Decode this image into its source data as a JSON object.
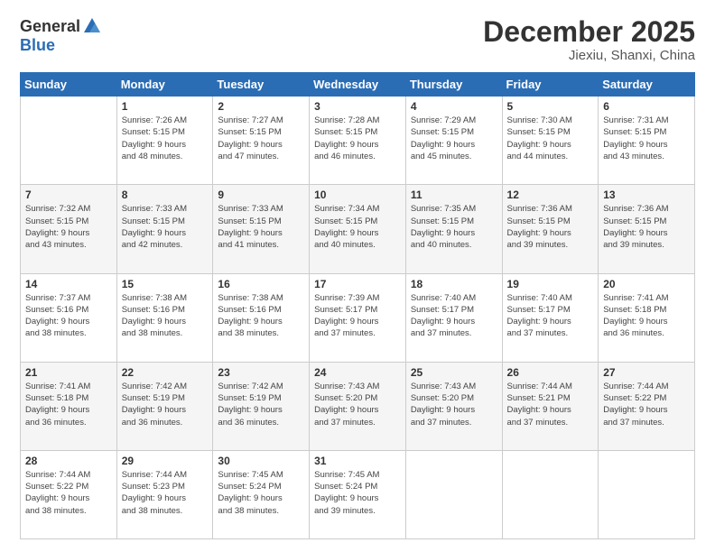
{
  "logo": {
    "general": "General",
    "blue": "Blue"
  },
  "title": "December 2025",
  "location": "Jiexiu, Shanxi, China",
  "days_of_week": [
    "Sunday",
    "Monday",
    "Tuesday",
    "Wednesday",
    "Thursday",
    "Friday",
    "Saturday"
  ],
  "weeks": [
    [
      {
        "day": "",
        "content": ""
      },
      {
        "day": "1",
        "content": "Sunrise: 7:26 AM\nSunset: 5:15 PM\nDaylight: 9 hours\nand 48 minutes."
      },
      {
        "day": "2",
        "content": "Sunrise: 7:27 AM\nSunset: 5:15 PM\nDaylight: 9 hours\nand 47 minutes."
      },
      {
        "day": "3",
        "content": "Sunrise: 7:28 AM\nSunset: 5:15 PM\nDaylight: 9 hours\nand 46 minutes."
      },
      {
        "day": "4",
        "content": "Sunrise: 7:29 AM\nSunset: 5:15 PM\nDaylight: 9 hours\nand 45 minutes."
      },
      {
        "day": "5",
        "content": "Sunrise: 7:30 AM\nSunset: 5:15 PM\nDaylight: 9 hours\nand 44 minutes."
      },
      {
        "day": "6",
        "content": "Sunrise: 7:31 AM\nSunset: 5:15 PM\nDaylight: 9 hours\nand 43 minutes."
      }
    ],
    [
      {
        "day": "7",
        "content": "Sunrise: 7:32 AM\nSunset: 5:15 PM\nDaylight: 9 hours\nand 43 minutes."
      },
      {
        "day": "8",
        "content": "Sunrise: 7:33 AM\nSunset: 5:15 PM\nDaylight: 9 hours\nand 42 minutes."
      },
      {
        "day": "9",
        "content": "Sunrise: 7:33 AM\nSunset: 5:15 PM\nDaylight: 9 hours\nand 41 minutes."
      },
      {
        "day": "10",
        "content": "Sunrise: 7:34 AM\nSunset: 5:15 PM\nDaylight: 9 hours\nand 40 minutes."
      },
      {
        "day": "11",
        "content": "Sunrise: 7:35 AM\nSunset: 5:15 PM\nDaylight: 9 hours\nand 40 minutes."
      },
      {
        "day": "12",
        "content": "Sunrise: 7:36 AM\nSunset: 5:15 PM\nDaylight: 9 hours\nand 39 minutes."
      },
      {
        "day": "13",
        "content": "Sunrise: 7:36 AM\nSunset: 5:15 PM\nDaylight: 9 hours\nand 39 minutes."
      }
    ],
    [
      {
        "day": "14",
        "content": "Sunrise: 7:37 AM\nSunset: 5:16 PM\nDaylight: 9 hours\nand 38 minutes."
      },
      {
        "day": "15",
        "content": "Sunrise: 7:38 AM\nSunset: 5:16 PM\nDaylight: 9 hours\nand 38 minutes."
      },
      {
        "day": "16",
        "content": "Sunrise: 7:38 AM\nSunset: 5:16 PM\nDaylight: 9 hours\nand 38 minutes."
      },
      {
        "day": "17",
        "content": "Sunrise: 7:39 AM\nSunset: 5:17 PM\nDaylight: 9 hours\nand 37 minutes."
      },
      {
        "day": "18",
        "content": "Sunrise: 7:40 AM\nSunset: 5:17 PM\nDaylight: 9 hours\nand 37 minutes."
      },
      {
        "day": "19",
        "content": "Sunrise: 7:40 AM\nSunset: 5:17 PM\nDaylight: 9 hours\nand 37 minutes."
      },
      {
        "day": "20",
        "content": "Sunrise: 7:41 AM\nSunset: 5:18 PM\nDaylight: 9 hours\nand 36 minutes."
      }
    ],
    [
      {
        "day": "21",
        "content": "Sunrise: 7:41 AM\nSunset: 5:18 PM\nDaylight: 9 hours\nand 36 minutes."
      },
      {
        "day": "22",
        "content": "Sunrise: 7:42 AM\nSunset: 5:19 PM\nDaylight: 9 hours\nand 36 minutes."
      },
      {
        "day": "23",
        "content": "Sunrise: 7:42 AM\nSunset: 5:19 PM\nDaylight: 9 hours\nand 36 minutes."
      },
      {
        "day": "24",
        "content": "Sunrise: 7:43 AM\nSunset: 5:20 PM\nDaylight: 9 hours\nand 37 minutes."
      },
      {
        "day": "25",
        "content": "Sunrise: 7:43 AM\nSunset: 5:20 PM\nDaylight: 9 hours\nand 37 minutes."
      },
      {
        "day": "26",
        "content": "Sunrise: 7:44 AM\nSunset: 5:21 PM\nDaylight: 9 hours\nand 37 minutes."
      },
      {
        "day": "27",
        "content": "Sunrise: 7:44 AM\nSunset: 5:22 PM\nDaylight: 9 hours\nand 37 minutes."
      }
    ],
    [
      {
        "day": "28",
        "content": "Sunrise: 7:44 AM\nSunset: 5:22 PM\nDaylight: 9 hours\nand 38 minutes."
      },
      {
        "day": "29",
        "content": "Sunrise: 7:44 AM\nSunset: 5:23 PM\nDaylight: 9 hours\nand 38 minutes."
      },
      {
        "day": "30",
        "content": "Sunrise: 7:45 AM\nSunset: 5:24 PM\nDaylight: 9 hours\nand 38 minutes."
      },
      {
        "day": "31",
        "content": "Sunrise: 7:45 AM\nSunset: 5:24 PM\nDaylight: 9 hours\nand 39 minutes."
      },
      {
        "day": "",
        "content": ""
      },
      {
        "day": "",
        "content": ""
      },
      {
        "day": "",
        "content": ""
      }
    ]
  ]
}
